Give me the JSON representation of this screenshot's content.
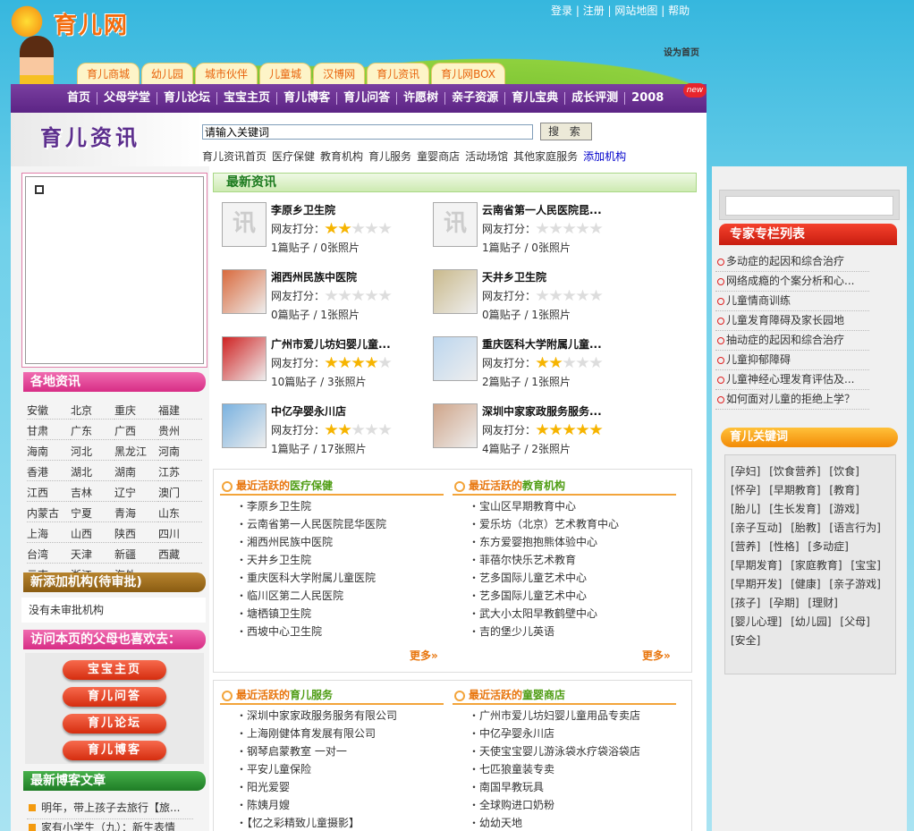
{
  "site": {
    "logo_text": "育儿网"
  },
  "top_links": [
    "登录",
    "注册",
    "网站地图",
    "帮助"
  ],
  "set_home": "设为首页",
  "tabs": [
    "育儿商城",
    "幼儿园",
    "城市伙伴",
    "儿童城",
    "汉博网",
    "育儿资讯",
    "育儿网BOX"
  ],
  "nav": [
    "首页",
    "父母学堂",
    "育儿论坛",
    "宝宝主页",
    "育儿博客",
    "育儿问答",
    "许愿树",
    "亲子资源",
    "育儿宝典",
    "成长评测",
    "2008"
  ],
  "nav_badge": "new",
  "section": {
    "title": "育儿资讯"
  },
  "search": {
    "value": "请输入关键词",
    "button": "搜 索"
  },
  "category_links": [
    "育儿资讯首页",
    "医疗保健",
    "教育机构",
    "育儿服务",
    "童婴商店",
    "活动场馆",
    "其他家庭服务"
  ],
  "add_link": "添加机构",
  "left": {
    "regions_title": "各地资讯",
    "regions": [
      "安徽",
      "北京",
      "重庆",
      "福建",
      "甘肃",
      "广东",
      "广西",
      "贵州",
      "海南",
      "河北",
      "黑龙江",
      "河南",
      "香港",
      "湖北",
      "湖南",
      "江苏",
      "江西",
      "吉林",
      "辽宁",
      "澳门",
      "内蒙古",
      "宁夏",
      "青海",
      "山东",
      "上海",
      "山西",
      "陕西",
      "四川",
      "台湾",
      "天津",
      "新疆",
      "西藏",
      "云南",
      "浙江",
      "海外"
    ],
    "new_title": "新添加机构(待审批)",
    "pending_text": "没有未审批机构",
    "parents_title": "访问本页的父母也喜欢去：",
    "parents_buttons": [
      "宝宝主页",
      "育儿问答",
      "育儿论坛",
      "育儿博客"
    ],
    "blog_title": "最新博客文章",
    "blog_items": [
      "明年，带上孩子去旅行【旅...",
      "家有小学生（九）：新生表情"
    ]
  },
  "latest": {
    "title": "最新资讯",
    "rating_label": "网友打分：",
    "cards": [
      {
        "name": "李原乡卫生院",
        "rating": 2,
        "counts": "1篇贴子 / 0张照片",
        "placeholder": "讯"
      },
      {
        "name": "云南省第一人民医院昆...",
        "rating": 0,
        "counts": "1篇贴子 / 0张照片",
        "placeholder": "讯"
      },
      {
        "name": "湘西州民族中医院",
        "rating": 0,
        "counts": "0篇贴子 / 1张照片",
        "placeholder": ""
      },
      {
        "name": "天井乡卫生院",
        "rating": 0,
        "counts": "0篇贴子 / 1张照片",
        "placeholder": ""
      },
      {
        "name": "广州市爱儿坊妇婴儿童...",
        "rating": 4,
        "counts": "10篇贴子 / 3张照片",
        "placeholder": ""
      },
      {
        "name": "重庆医科大学附属儿童...",
        "rating": 2,
        "counts": "2篇贴子 / 1张照片",
        "placeholder": ""
      },
      {
        "name": "中亿孕婴永川店",
        "rating": 2,
        "counts": "1篇贴子 / 17张照片",
        "placeholder": ""
      },
      {
        "name": "深圳中家家政服务服务...",
        "rating": 5,
        "counts": "4篇贴子 / 2张照片",
        "placeholder": ""
      }
    ]
  },
  "active": {
    "prefix": "最近活跃的",
    "more": "更多»",
    "medical": {
      "label": "医疗保健",
      "items": [
        "李原乡卫生院",
        "云南省第一人民医院昆华医院",
        "湘西州民族中医院",
        "天井乡卫生院",
        "重庆医科大学附属儿童医院",
        "临川区第二人民医院",
        "塘栖镇卫生院",
        "西坡中心卫生院"
      ]
    },
    "education": {
      "label": "教育机构",
      "items": [
        "宝山区早期教育中心",
        "爱乐坊（北京）艺术教育中心",
        "东方爱婴抱抱熊体验中心",
        "菲蓓尔快乐艺术教育",
        "艺多国际儿童艺术中心",
        "艺多国际儿童艺术中心",
        "武大小太阳早教鹤壁中心",
        "吉的堡少儿英语"
      ]
    },
    "service": {
      "label": "育儿服务",
      "items": [
        "深圳中家家政服务服务有限公司",
        "上海刚健体育发展有限公司",
        "钢琴启蒙教室 一对一",
        "平安儿童保险",
        "阳光爱婴",
        "陈姨月嫂",
        "【忆之彩精致儿童摄影】"
      ]
    },
    "shop": {
      "label": "童婴商店",
      "items": [
        "广州市爱儿坊妇婴儿童用品专卖店",
        "中亿孕婴永川店",
        "天使宝宝婴儿游泳袋水疗袋浴袋店",
        "七匹狼童装专卖",
        "南国早教玩具",
        "全球购进口奶粉",
        "幼幼天地"
      ]
    }
  },
  "right": {
    "expert_title": "专家专栏列表",
    "expert_items": [
      "多动症的起因和综合治疗",
      "网络成瘾的个案分析和心...",
      "儿童情商训练",
      "儿童发育障碍及家长园地",
      "抽动症的起因和综合治疗",
      "儿童抑郁障碍",
      "儿童神经心理发育评估及...",
      "如何面对儿童的拒绝上学？"
    ],
    "keywords_title": "育儿关键词",
    "keywords": [
      "[孕妇]",
      "[饮食营养]",
      "[饮食]",
      "[怀孕]",
      "[早期教育]",
      "[教育]",
      "[胎儿]",
      "[生长发育]",
      "[游戏]",
      "[亲子互动]",
      "[胎教]",
      "[语言行为]",
      "[营养]",
      "[性格]",
      "[多动症]",
      "[早期发育]",
      "[家庭教育]",
      "[宝宝]",
      "[早期开发]",
      "[健康]",
      "[亲子游戏]",
      "[孩子]",
      "[孕期]",
      "[理财]",
      "[婴儿心理]",
      "[幼儿园]",
      "[父母]",
      "[安全]"
    ]
  }
}
